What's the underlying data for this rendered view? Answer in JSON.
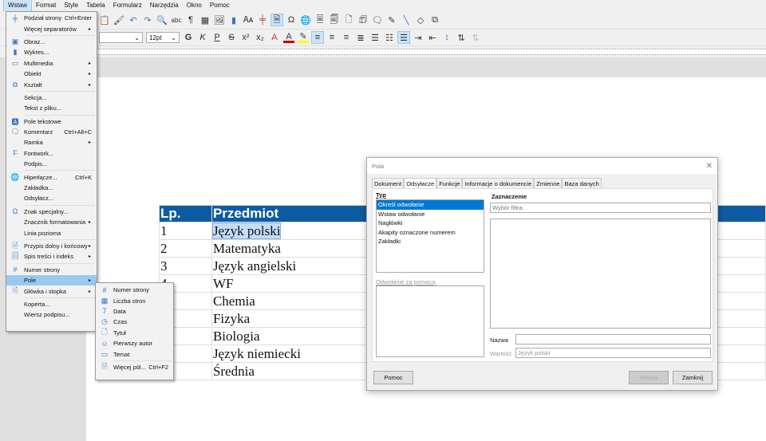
{
  "menubar": {
    "items": [
      "Wstaw",
      "Format",
      "Style",
      "Tabela",
      "Formularz",
      "Narzędzia",
      "Okno",
      "Pomoc"
    ]
  },
  "toolbar": {
    "font_size": "12pt"
  },
  "insert_menu": {
    "items": [
      {
        "label": "Podział strony",
        "shortcut": "Ctrl+Enter",
        "icon": "page-break-icon"
      },
      {
        "label": "Więcej separatorów",
        "submenu": true
      },
      {
        "sep": true
      },
      {
        "label": "Obraz...",
        "icon": "image-icon"
      },
      {
        "label": "Wykres...",
        "icon": "chart-icon"
      },
      {
        "label": "Multimedia",
        "submenu": true,
        "icon": "media-icon"
      },
      {
        "label": "Obiekt",
        "submenu": true
      },
      {
        "label": "Kształt",
        "submenu": true,
        "icon": "shapes-icon"
      },
      {
        "sep": true
      },
      {
        "label": "Sekcja..."
      },
      {
        "label": "Tekst z pliku..."
      },
      {
        "sep": true
      },
      {
        "label": "Pole tekstowe",
        "icon": "text-box-icon"
      },
      {
        "label": "Komentarz",
        "shortcut": "Ctrl+Alt+C",
        "icon": "comment-icon"
      },
      {
        "label": "Ramka",
        "submenu": true
      },
      {
        "label": "Fontwork...",
        "icon": "fontwork-icon"
      },
      {
        "label": "Podpis..."
      },
      {
        "sep": true
      },
      {
        "label": "Hiperłącze...",
        "shortcut": "Ctrl+K",
        "icon": "hyperlink-icon"
      },
      {
        "label": "Zakładka..."
      },
      {
        "label": "Odsyłacz..."
      },
      {
        "sep": true
      },
      {
        "label": "Znak specjalny...",
        "icon": "omega-icon"
      },
      {
        "label": "Znacznik formatowania",
        "submenu": true
      },
      {
        "label": "Linia pozioma"
      },
      {
        "sep": true
      },
      {
        "label": "Przypis dolny i końcowy",
        "submenu": true,
        "icon": "footnote-icon"
      },
      {
        "label": "Spis treści i indeks",
        "submenu": true,
        "icon": "toc-icon"
      },
      {
        "sep": true
      },
      {
        "label": "Numer strony",
        "icon": "page-number-icon"
      },
      {
        "label": "Pole",
        "submenu": true,
        "active": true
      },
      {
        "label": "Główka i stopka",
        "submenu": true,
        "icon": "header-footer-icon"
      },
      {
        "sep": true
      },
      {
        "label": "Koperta..."
      },
      {
        "label": "Wiersz podpisu..."
      }
    ]
  },
  "field_submenu": {
    "items": [
      {
        "label": "Numer strony",
        "icon": "page-number-icon"
      },
      {
        "label": "Liczba stron",
        "icon": "page-count-icon"
      },
      {
        "label": "Data",
        "icon": "calendar-icon"
      },
      {
        "label": "Czas",
        "icon": "clock-icon"
      },
      {
        "label": "Tytuł",
        "icon": "title-icon"
      },
      {
        "label": "Pierwszy autor",
        "icon": "person-icon"
      },
      {
        "label": "Temat",
        "icon": "subject-icon"
      },
      {
        "sep": true
      },
      {
        "label": "Więcej pól...",
        "shortcut": "Ctrl+F2",
        "icon": "more-fields-icon"
      }
    ]
  },
  "table": {
    "headers": [
      "Lp.",
      "Przedmiot"
    ],
    "rows": [
      [
        "1",
        "Język polski"
      ],
      [
        "2",
        "Matematyka"
      ],
      [
        "3",
        "Język angielski"
      ],
      [
        "4",
        "WF"
      ],
      [
        "",
        "Chemia"
      ],
      [
        "",
        "Fizyka"
      ],
      [
        "",
        "Biologia"
      ],
      [
        "",
        "Język niemiecki"
      ],
      [
        "",
        "Średnia"
      ]
    ]
  },
  "dialog": {
    "title": "Pola",
    "tabs": [
      "Dokument",
      "Odsyłacze",
      "Funkcje",
      "Informacje o dokumencie",
      "Zmienne",
      "Baza danych"
    ],
    "active_tab": 1,
    "type_label": "Typ",
    "types": [
      "Określ odwołanie",
      "Wstaw odwołanie",
      "Nagłówki",
      "Akapity oznaczone numerem",
      "Zakładki"
    ],
    "selection_label": "Zaznaczenie",
    "filter_placeholder": "Wybór filtra",
    "ref_using_label": "Odwołanie za pomocą:",
    "name_label": "Nazwa",
    "name_value": "",
    "value_label": "Wartość",
    "value_value": "Język polski",
    "help": "Pomoc",
    "insert": "Wstaw",
    "close": "Zamknij"
  },
  "colors": {
    "accent": "#0078d7",
    "table_header": "#0e5ba3",
    "menu_highlight": "#99c9ef"
  }
}
